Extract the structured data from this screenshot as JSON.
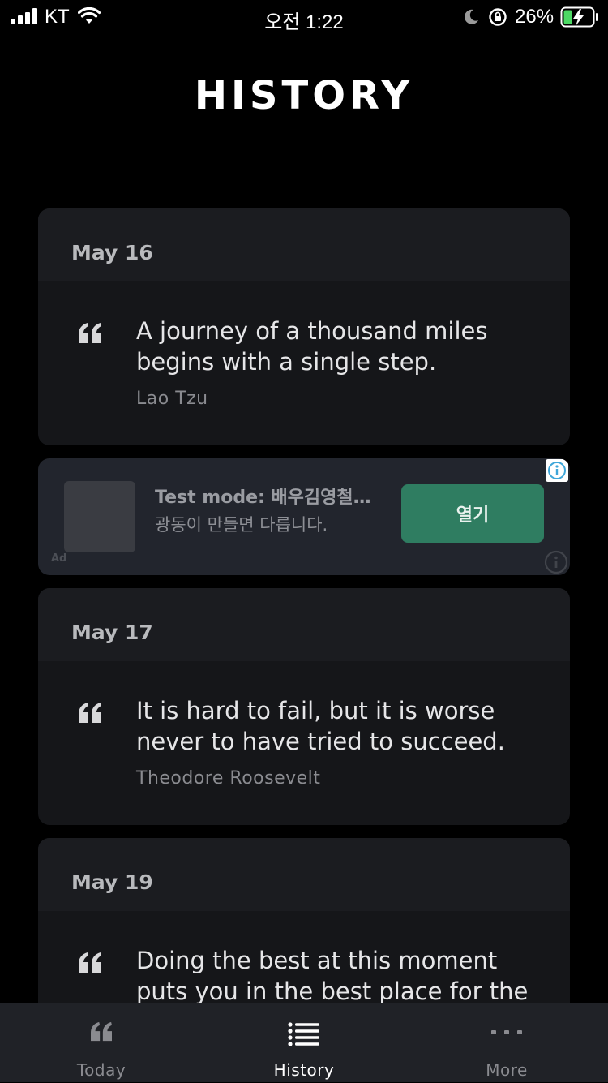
{
  "status_bar": {
    "carrier": "KT",
    "time": "오전 1:22",
    "battery_percent": "26%"
  },
  "header": {
    "title": "HISTORY"
  },
  "cards": [
    {
      "date": "May 16",
      "quote": "A journey of a thousand miles begins with a single step.",
      "author": "Lao Tzu"
    },
    {
      "date": "May 17",
      "quote": "It is hard to fail, but it is worse never to have tried to succeed.",
      "author": "Theodore Roosevelt"
    },
    {
      "date": "May 19",
      "quote": "Doing the best at this moment puts you in the best place for the",
      "author": ""
    }
  ],
  "ad": {
    "title": "Test mode: 배우김영철…",
    "description": "광동이 만들면 다릅니다.",
    "button_label": "열기",
    "label": "Ad"
  },
  "tab_bar": {
    "tabs": [
      {
        "label": "Today",
        "icon": "quote-icon"
      },
      {
        "label": "History",
        "icon": "list-icon"
      },
      {
        "label": "More",
        "icon": "more-icon"
      }
    ],
    "active": "History"
  },
  "colors": {
    "background": "#000000",
    "card": "#151619",
    "ad_button": "#2f7d61",
    "tab_bar": "#202227"
  }
}
